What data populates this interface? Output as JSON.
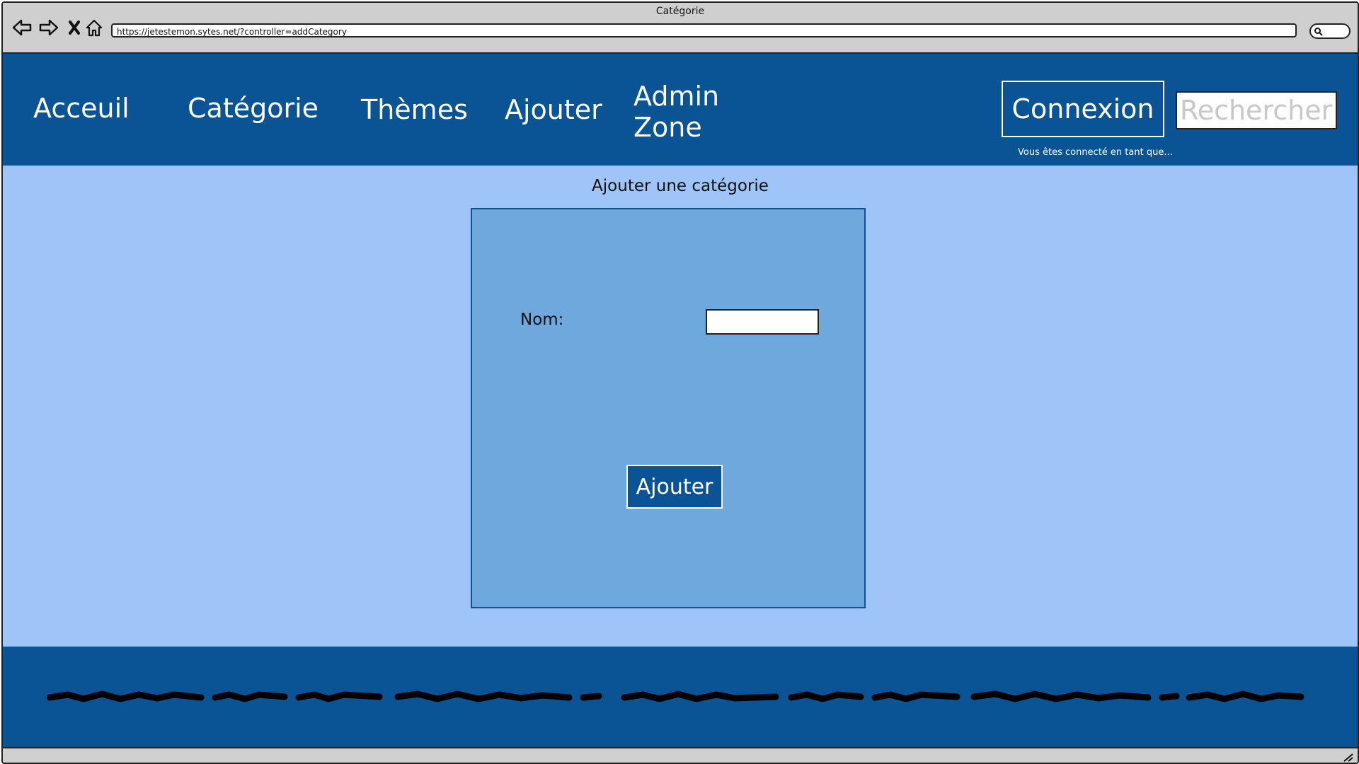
{
  "browser": {
    "window_title": "Catégorie",
    "url": "https://jetestemon.sytes.net/?controller=addCategory",
    "icons": [
      "back-icon",
      "forward-icon",
      "close-icon",
      "home-icon",
      "search-icon"
    ]
  },
  "header": {
    "menu": {
      "home": "Acceuil",
      "category": "Catégorie",
      "themes": "Thèmes",
      "add": "Ajouter",
      "admin_line1": "Admin",
      "admin_line2": "Zone"
    },
    "login_label": "Connexion",
    "search_placeholder": "Rechercher",
    "login_status": "Vous êtes connecté en tant que..."
  },
  "main": {
    "title": "Ajouter une catégorie",
    "form": {
      "name_label": "Nom:",
      "name_value": "",
      "submit_label": "Ajouter"
    }
  },
  "colors": {
    "header_bg": "#0a5395",
    "content_bg": "#9fc4f7",
    "form_bg": "#6fa8dc",
    "chrome_bg": "#cfcfcf"
  }
}
